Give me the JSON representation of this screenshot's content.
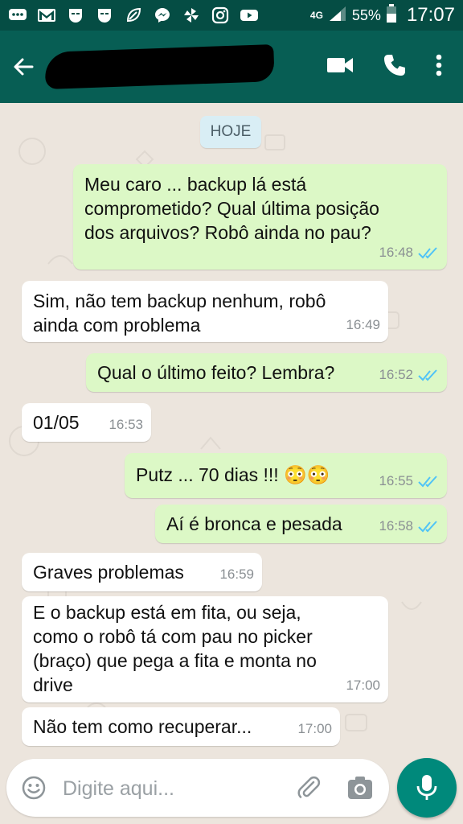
{
  "status_bar": {
    "network": "4G",
    "battery": "55%",
    "time": "17:07"
  },
  "chat": {
    "date_divider": "HOJE",
    "messages": [
      {
        "direction": "out",
        "text_lines": [
          "Meu caro ... backup lá está",
          "comprometido? Qual última posição",
          "dos arquivos? Robô ainda no pau?"
        ],
        "time": "16:48",
        "status": "read"
      },
      {
        "direction": "in",
        "text_lines": [
          "Sim, não tem backup nenhum, robô",
          "ainda com problema"
        ],
        "time": "16:49"
      },
      {
        "direction": "out",
        "text_lines": [
          "Qual o último feito? Lembra?"
        ],
        "time": "16:52",
        "status": "read"
      },
      {
        "direction": "in",
        "text_lines": [
          "01/05"
        ],
        "time": "16:53"
      },
      {
        "direction": "out",
        "text_lines": [
          "Putz ... 70 dias !!! 😳😳"
        ],
        "time": "16:55",
        "status": "read"
      },
      {
        "direction": "out",
        "text_lines": [
          "Aí é bronca e pesada"
        ],
        "time": "16:58",
        "status": "read"
      },
      {
        "direction": "in",
        "text_lines": [
          "Graves problemas"
        ],
        "time": "16:59"
      },
      {
        "direction": "in",
        "text_lines": [
          "E o backup está em fita, ou seja,",
          "como o robô tá com pau no picker",
          "(braço) que pega a fita e monta no",
          "drive"
        ],
        "time": "17:00"
      },
      {
        "direction": "in",
        "text_lines": [
          "Não tem como recuperar..."
        ],
        "time": "17:00"
      }
    ]
  },
  "input": {
    "placeholder": "Digite aqui..."
  },
  "colors": {
    "status_bar": "#054d44",
    "app_bar": "#075e54",
    "outgoing_bubble": "#dcf8c6",
    "incoming_bubble": "#ffffff",
    "chat_background": "#ece5dd",
    "read_ticks": "#4fc3f7",
    "mic_button": "#00897b"
  },
  "icons": [
    "gmail-icon",
    "mail-icon",
    "vivino-icon",
    "mask-icon",
    "messenger-icon",
    "pinwheel-icon",
    "instagram-icon",
    "youtube-icon",
    "signal-icon",
    "battery-icon",
    "back-arrow-icon",
    "video-call-icon",
    "phone-icon",
    "more-icon",
    "emoji-icon",
    "paperclip-icon",
    "camera-icon",
    "mic-icon"
  ]
}
